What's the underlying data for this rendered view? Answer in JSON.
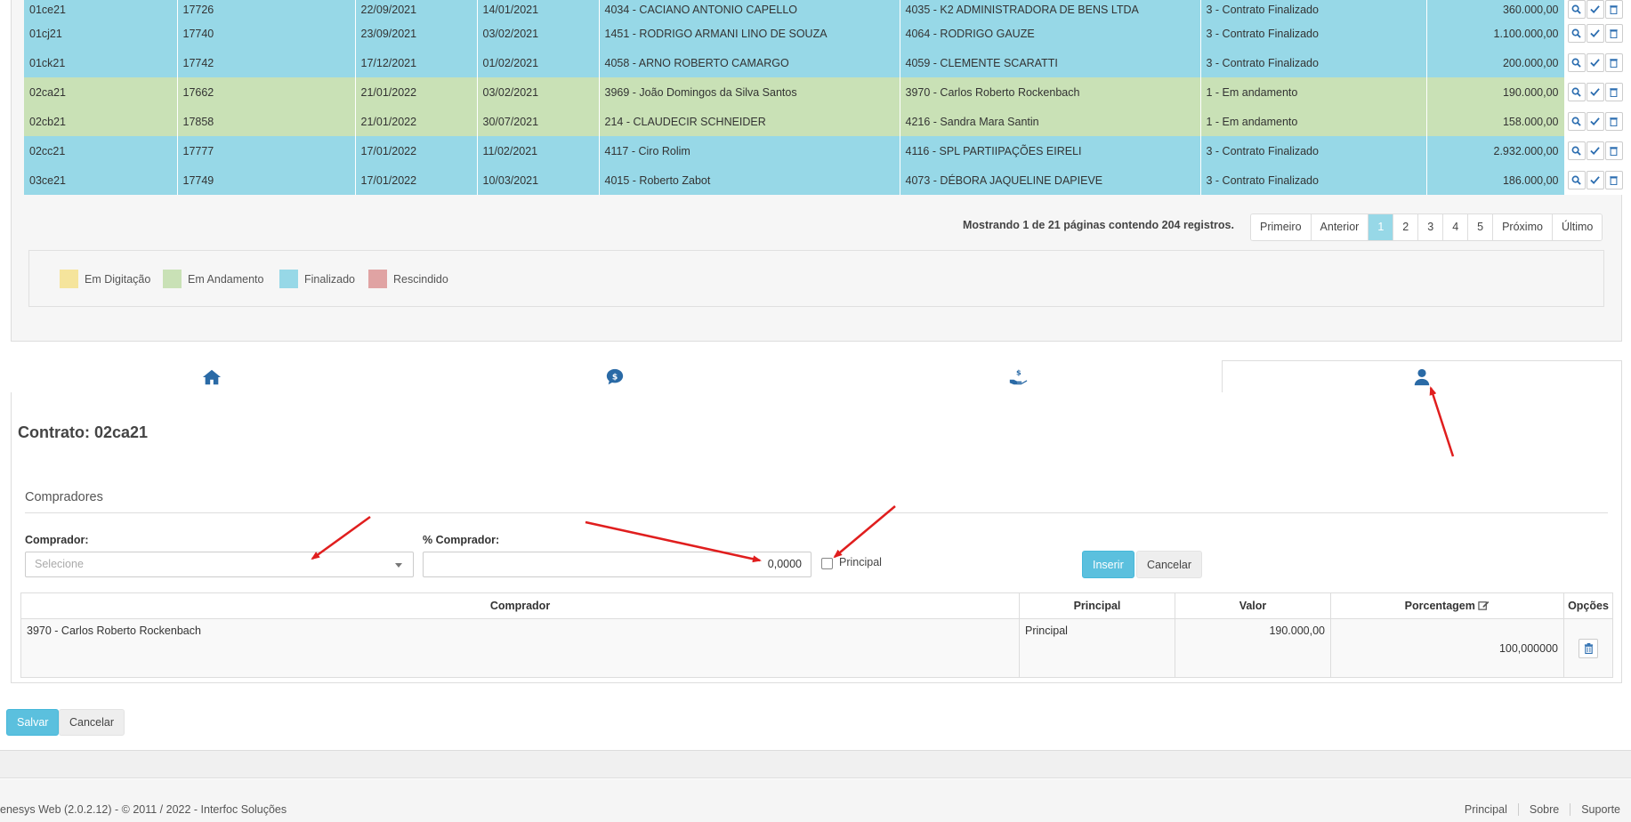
{
  "rows": [
    {
      "code": "01ce21",
      "num": "17726",
      "d1": "22/09/2021",
      "d2": "14/01/2021",
      "vend": "4034 - CACIANO ANTONIO CAPELLO",
      "comp": "4035 - K2 ADMINISTRADORA DE BENS LTDA",
      "status": "3 - Contrato Finalizado",
      "valor": "360.000,00",
      "kind": "fin"
    },
    {
      "code": "01cj21",
      "num": "17740",
      "d1": "23/09/2021",
      "d2": "03/02/2021",
      "vend": "1451 - RODRIGO ARMANI LINO DE SOUZA",
      "comp": "4064 - RODRIGO GAUZE",
      "status": "3 - Contrato Finalizado",
      "valor": "1.100.000,00",
      "kind": "fin"
    },
    {
      "code": "01ck21",
      "num": "17742",
      "d1": "17/12/2021",
      "d2": "01/02/2021",
      "vend": "4058 - ARNO ROBERTO CAMARGO",
      "comp": "4059 - CLEMENTE SCARATTI",
      "status": "3 - Contrato Finalizado",
      "valor": "200.000,00",
      "kind": "fin"
    },
    {
      "code": "02ca21",
      "num": "17662",
      "d1": "21/01/2022",
      "d2": "03/02/2021",
      "vend": "3969 - João Domingos da Silva Santos",
      "comp": "3970 - Carlos Roberto Rockenbach",
      "status": "1 - Em andamento",
      "valor": "190.000,00",
      "kind": "and"
    },
    {
      "code": "02cb21",
      "num": "17858",
      "d1": "21/01/2022",
      "d2": "30/07/2021",
      "vend": "214 - CLAUDECIR SCHNEIDER",
      "comp": "4216 - Sandra Mara Santin",
      "status": "1 - Em andamento",
      "valor": "158.000,00",
      "kind": "and"
    },
    {
      "code": "02cc21",
      "num": "17777",
      "d1": "17/01/2022",
      "d2": "11/02/2021",
      "vend": "4117 - Ciro Rolim",
      "comp": "4116 - SPL PARTIIPAÇÕES EIRELI",
      "status": "3 - Contrato Finalizado",
      "valor": "2.932.000,00",
      "kind": "fin"
    },
    {
      "code": "03ce21",
      "num": "17749",
      "d1": "17/01/2022",
      "d2": "10/03/2021",
      "vend": "4015 - Roberto Zabot",
      "comp": "4073 - DÉBORA JAQUELINE DAPIEVE",
      "status": "3 - Contrato Finalizado",
      "valor": "186.000,00",
      "kind": "fin"
    }
  ],
  "pager": {
    "info": "Mostrando 1 de 21 páginas contendo 204 registros.",
    "first": "Primeiro",
    "prev": "Anterior",
    "next": "Próximo",
    "last": "Último",
    "pages": [
      "1",
      "2",
      "3",
      "4",
      "5"
    ],
    "active": "1"
  },
  "legend": [
    {
      "label": "Em Digitação",
      "color": "#f5e49c"
    },
    {
      "label": "Em Andamento",
      "color": "#c9e1b6"
    },
    {
      "label": "Finalizado",
      "color": "#97d8e7"
    },
    {
      "label": "Rescindido",
      "color": "#e0a3a3"
    }
  ],
  "tabs": [
    "home-icon",
    "money-chat-icon",
    "hand-money-icon",
    "user-icon"
  ],
  "contract": {
    "title": "Contrato: 02ca21"
  },
  "section": {
    "title": "Compradores"
  },
  "form": {
    "buyer_label": "Comprador:",
    "buyer_placeholder": "Selecione",
    "pct_label": "% Comprador:",
    "pct_value": "0,0000",
    "principal_label": "Principal",
    "insert": "Inserir",
    "cancel": "Cancelar"
  },
  "buyers_table": {
    "headers": {
      "comprador": "Comprador",
      "principal": "Principal",
      "valor": "Valor",
      "porcentagem": "Porcentagem",
      "opcoes": "Opções"
    },
    "rows": [
      {
        "comprador": "3970 - Carlos Roberto Rockenbach",
        "principal": "Principal",
        "valor": "190.000,00",
        "porcentagem": "100,000000"
      }
    ]
  },
  "actions": {
    "save": "Salvar",
    "cancel": "Cancelar"
  },
  "footer": {
    "left": "enesys Web (2.0.2.12) - © 2011 / 2022 - Interfoc Soluções",
    "links": [
      "Principal",
      "Sobre",
      "Suporte"
    ]
  },
  "colors": {
    "accent": "#5bc0de",
    "finalizado": "#97d8e7",
    "andamento": "#c9e1b6",
    "arrow": "#e01e1e",
    "icon": "#2a6aa6"
  }
}
